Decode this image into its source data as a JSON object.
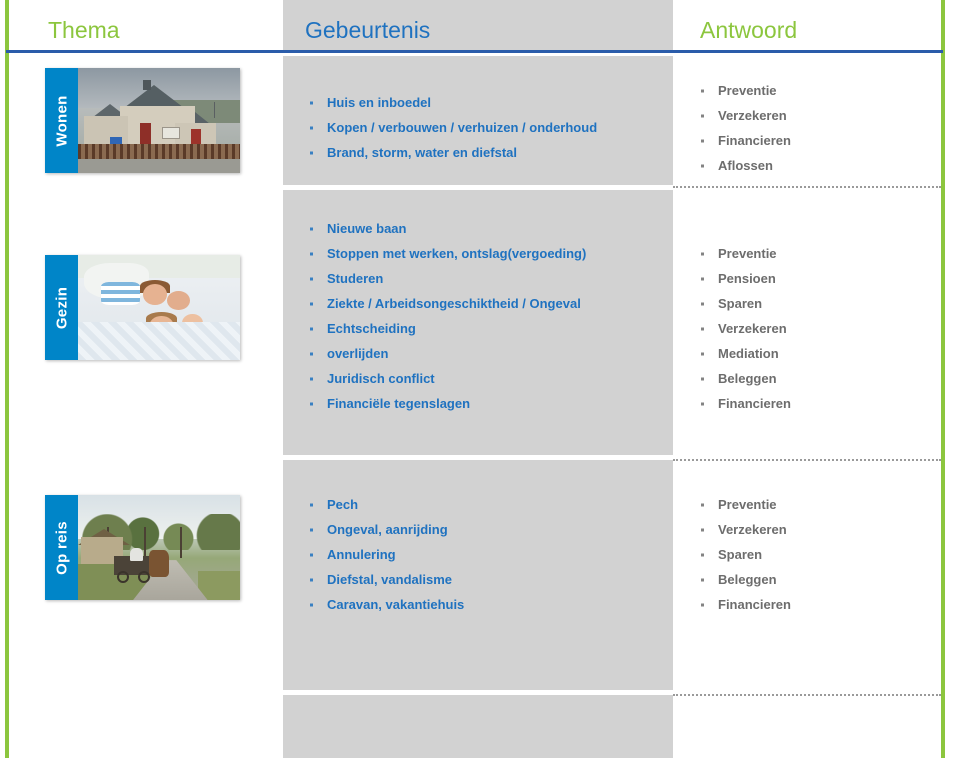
{
  "header": {
    "columns": [
      {
        "label": "Thema",
        "color": "#8cc63e"
      },
      {
        "label": "Gebeurtenis",
        "color": "#1f72c0"
      },
      {
        "label": "Antwoord",
        "color": "#8cc63e"
      }
    ],
    "rule_color": "#2a5caa"
  },
  "theme_colors": {
    "accent_green": "#8cc63e",
    "tab_blue": "#0085c8",
    "event_text": "#1f72c0",
    "answer_text": "#6d6d6d",
    "band_gray": "#d2d2d2"
  },
  "rows": [
    {
      "theme": "Wonen",
      "photo": "houses-photo",
      "events": [
        "Huis en inboedel",
        "Kopen / verbouwen / verhuizen / onderhoud",
        "Brand, storm, water en diefstal"
      ],
      "answers": [
        "Preventie",
        "Verzekeren",
        "Financieren",
        "Aflossen"
      ]
    },
    {
      "theme": "Gezin",
      "photo": "family-photo",
      "events": [
        "Nieuwe baan",
        "Stoppen met werken, ontslag(vergoeding)",
        "Studeren",
        "Ziekte / Arbeidsongeschiktheid / Ongeval",
        "Echtscheiding",
        "overlijden",
        "Juridisch conflict",
        "Financiële tegenslagen"
      ],
      "answers": [
        "Preventie",
        "Pensioen",
        "Sparen",
        "Verzekeren",
        "Mediation",
        "Beleggen",
        "Financieren"
      ]
    },
    {
      "theme": "Op reis",
      "photo": "country-road-photo",
      "events": [
        "Pech",
        "Ongeval, aanrijding",
        "Annulering",
        "Diefstal, vandalisme",
        "Caravan, vakantiehuis"
      ],
      "answers": [
        "Preventie",
        "Verzekeren",
        "Sparen",
        "Beleggen",
        "Financieren"
      ]
    }
  ]
}
